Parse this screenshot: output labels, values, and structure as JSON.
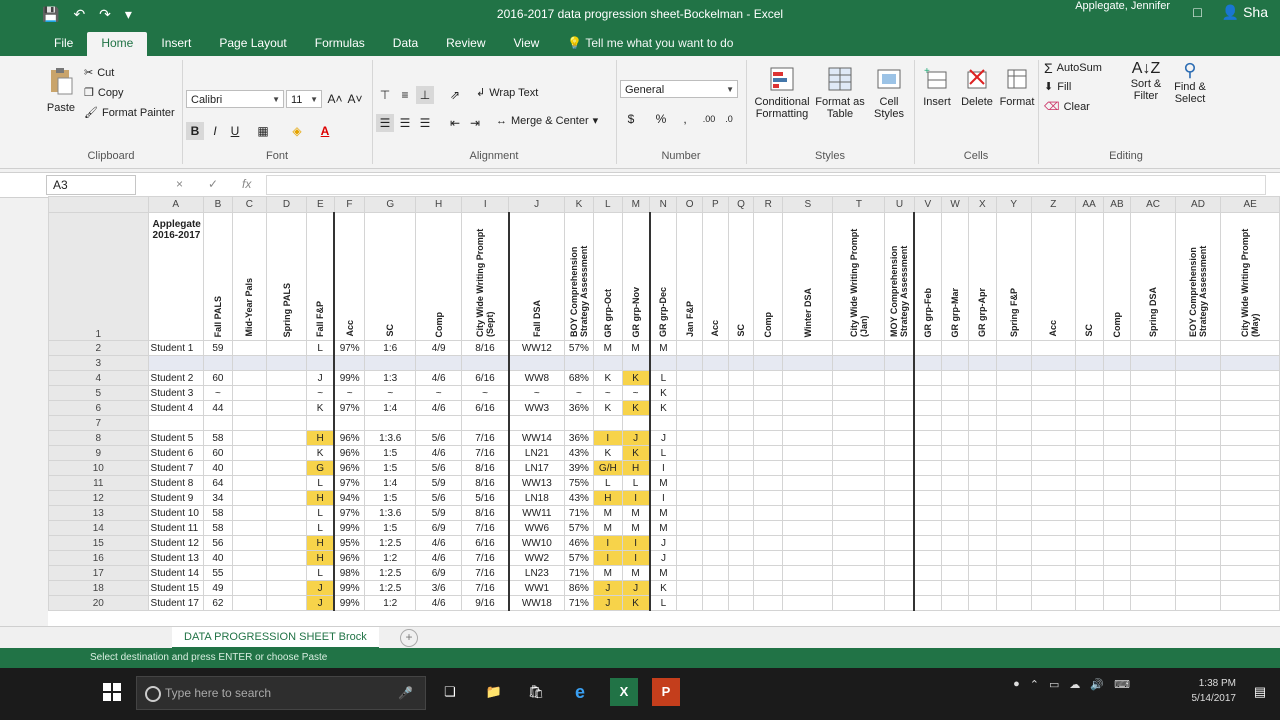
{
  "window": {
    "title": "2016-2017 data progression sheet-Bockelman  -  Excel",
    "user": "Applegate, Jennifer",
    "share": "Sha"
  },
  "tabs": [
    "File",
    "Home",
    "Insert",
    "Page Layout",
    "Formulas",
    "Data",
    "Review",
    "View"
  ],
  "tell_me": "Tell me what you want to do",
  "ribbon": {
    "clipboard": {
      "paste": "Paste",
      "cut": "Cut",
      "copy": "Copy",
      "format_painter": "Format Painter",
      "label": "Clipboard"
    },
    "font": {
      "name": "Calibri",
      "size": "11",
      "bold": "B",
      "italic": "I",
      "underline": "U",
      "label": "Font"
    },
    "alignment": {
      "wrap": "Wrap Text",
      "merge": "Merge & Center",
      "label": "Alignment"
    },
    "number": {
      "format": "General",
      "currency": "$",
      "percent": "%",
      "comma": ",",
      "label": "Number"
    },
    "styles": {
      "conditional": "Conditional",
      "conditional2": "Formatting",
      "format_table": "Format as",
      "format_table2": "Table",
      "cell_styles": "Cell",
      "cell_styles2": "Styles",
      "label": "Styles"
    },
    "cells": {
      "insert": "Insert",
      "delete": "Delete",
      "format": "Format",
      "label": "Cells"
    },
    "editing": {
      "autosum": "AutoSum",
      "fill": "Fill",
      "clear": "Clear",
      "sort": "Sort &",
      "sort2": "Filter",
      "find": "Find &",
      "find2": "Select",
      "label": "Editing"
    }
  },
  "formula_bar": {
    "name_box": "A3",
    "fx": "fx",
    "cancel": "×",
    "enter": "✓"
  },
  "columns": [
    "A",
    "B",
    "C",
    "D",
    "E",
    "F",
    "G",
    "H",
    "I",
    "J",
    "K",
    "L",
    "M",
    "N",
    "O",
    "P",
    "Q",
    "R",
    "S",
    "T",
    "U",
    "V",
    "W",
    "X",
    "Y",
    "Z",
    "AA",
    "AB",
    "AC",
    "AD",
    "AE"
  ],
  "sheet_title": {
    "line1": "Applegate",
    "line2": "2016-2017"
  },
  "headers": [
    "Fall PALS",
    "Mid-Year Pals",
    "Spring PALS",
    "Fall F&P",
    "Acc",
    "SC",
    "Comp",
    "City Wide Writing Prompt (Sept)",
    "Fall DSA",
    "BOY Comprehension Strategy Assessment",
    "GR grp-Oct",
    "GR grp-Nov",
    "GR grp-Dec",
    "Jan F&P",
    "Acc",
    "SC",
    "Comp",
    "Winter DSA",
    "City Wide Writing Prompt (Jan)",
    "MOY Comprehension Strategy Assessment",
    "GR grp-Feb",
    "GR grp-Mar",
    "GR grp-Apr",
    "Spring F&P",
    "Acc",
    "SC",
    "Comp",
    "Spring DSA",
    "EOY Comprehension Strategy Assessment",
    "City Wide Writing Prompt (May)"
  ],
  "rows": [
    {
      "n": "2",
      "name": "Student 1",
      "v": [
        "59",
        "",
        "",
        "L",
        "97%",
        "1:6",
        "4/9",
        "8/16",
        "WW12",
        "57%",
        "M",
        "M",
        "M"
      ],
      "y": []
    },
    {
      "n": "3",
      "name": "",
      "v": [
        "",
        "",
        "",
        "",
        "",
        "",
        "",
        "",
        "",
        "",
        "",
        "",
        ""
      ],
      "y": []
    },
    {
      "n": "4",
      "name": "Student 2",
      "v": [
        "60",
        "",
        "",
        "J",
        "99%",
        "1:3",
        "4/6",
        "6/16",
        "WW8",
        "68%",
        "K",
        "K",
        "L"
      ],
      "y": [
        11
      ]
    },
    {
      "n": "5",
      "name": "Student 3",
      "v": [
        "~",
        "",
        "",
        "~",
        "~",
        "~",
        "~",
        "~",
        "~",
        "~",
        "~",
        "~",
        "K"
      ],
      "y": []
    },
    {
      "n": "6",
      "name": "Student 4",
      "v": [
        "44",
        "",
        "",
        "K",
        "97%",
        "1:4",
        "4/6",
        "6/16",
        "WW3",
        "36%",
        "K",
        "K",
        "K"
      ],
      "y": [
        11
      ]
    },
    {
      "n": "7",
      "name": "",
      "v": [
        "",
        "",
        "",
        "",
        "",
        "",
        "",
        "",
        "",
        "",
        "",
        "",
        ""
      ],
      "y": []
    },
    {
      "n": "8",
      "name": "Student 5",
      "v": [
        "58",
        "",
        "",
        "H",
        "96%",
        "1:3.6",
        "5/6",
        "7/16",
        "WW14",
        "36%",
        "I",
        "J",
        "J"
      ],
      "y": [
        3,
        10,
        11
      ]
    },
    {
      "n": "9",
      "name": "Student 6",
      "v": [
        "60",
        "",
        "",
        "K",
        "96%",
        "1:5",
        "4/6",
        "7/16",
        "LN21",
        "43%",
        "K",
        "K",
        "L"
      ],
      "y": [
        11
      ]
    },
    {
      "n": "10",
      "name": "Student 7",
      "v": [
        "40",
        "",
        "",
        "G",
        "96%",
        "1:5",
        "5/6",
        "8/16",
        "LN17",
        "39%",
        "G/H",
        "H",
        "I"
      ],
      "y": [
        3,
        10,
        11
      ]
    },
    {
      "n": "11",
      "name": "Student 8",
      "v": [
        "64",
        "",
        "",
        "L",
        "97%",
        "1:4",
        "5/9",
        "8/16",
        "WW13",
        "75%",
        "L",
        "L",
        "M"
      ],
      "y": []
    },
    {
      "n": "12",
      "name": "Student 9",
      "v": [
        "34",
        "",
        "",
        "H",
        "94%",
        "1:5",
        "5/6",
        "5/16",
        "LN18",
        "43%",
        "H",
        "I",
        "I"
      ],
      "y": [
        3,
        10,
        11
      ]
    },
    {
      "n": "13",
      "name": "Student 10",
      "v": [
        "58",
        "",
        "",
        "L",
        "97%",
        "1:3.6",
        "5/9",
        "8/16",
        "WW11",
        "71%",
        "M",
        "M",
        "M"
      ],
      "y": []
    },
    {
      "n": "14",
      "name": "Student 11",
      "v": [
        "58",
        "",
        "",
        "L",
        "99%",
        "1:5",
        "6/9",
        "7/16",
        "WW6",
        "57%",
        "M",
        "M",
        "M"
      ],
      "y": []
    },
    {
      "n": "15",
      "name": "Student 12",
      "v": [
        "56",
        "",
        "",
        "H",
        "95%",
        "1:2.5",
        "4/6",
        "6/16",
        "WW10",
        "46%",
        "I",
        "I",
        "J"
      ],
      "y": [
        3,
        10,
        11
      ]
    },
    {
      "n": "16",
      "name": "Student 13",
      "v": [
        "40",
        "",
        "",
        "H",
        "96%",
        "1:2",
        "4/6",
        "7/16",
        "WW2",
        "57%",
        "I",
        "I",
        "J"
      ],
      "y": [
        3,
        10,
        11
      ]
    },
    {
      "n": "17",
      "name": "Student 14",
      "v": [
        "55",
        "",
        "",
        "L",
        "98%",
        "1:2.5",
        "6/9",
        "7/16",
        "LN23",
        "71%",
        "M",
        "M",
        "M"
      ],
      "y": []
    },
    {
      "n": "18",
      "name": "Student 15",
      "v": [
        "49",
        "",
        "",
        "J",
        "99%",
        "1:2.5",
        "3/6",
        "7/16",
        "WW1",
        "86%",
        "J",
        "J",
        "K"
      ],
      "y": [
        3,
        10,
        11
      ]
    },
    {
      "n": "20",
      "name": "Student 17",
      "v": [
        "62",
        "",
        "",
        "J",
        "99%",
        "1:2",
        "4/6",
        "9/16",
        "WW18",
        "71%",
        "J",
        "K",
        "L"
      ],
      "y": [
        3,
        10,
        11
      ]
    }
  ],
  "sheet_tab": "DATA PROGRESSION SHEET Brock",
  "status_text": "Select destination and press ENTER or choose Paste",
  "taskbar": {
    "search_placeholder": "Type here to search",
    "time": "1:38 PM",
    "date": "5/14/2017"
  },
  "colors": {
    "excel_green": "#217346",
    "highlight_yellow": "#f7d34a"
  }
}
